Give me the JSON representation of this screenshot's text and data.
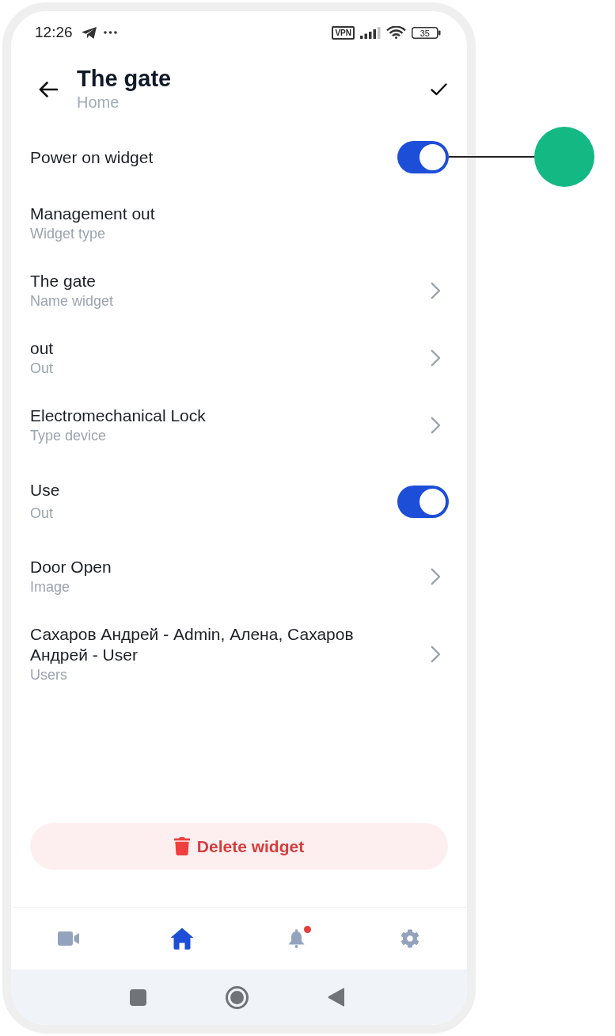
{
  "status_bar": {
    "time": "12:26",
    "vpn": "VPN",
    "battery": "35"
  },
  "header": {
    "title": "The gate",
    "subtitle": "Home"
  },
  "rows": [
    {
      "kind": "toggle",
      "label": "Power on widget",
      "on": true
    },
    {
      "kind": "info",
      "label": "Management out",
      "sublabel": "Widget type"
    },
    {
      "kind": "link",
      "label": "The gate",
      "sublabel": "Name widget"
    },
    {
      "kind": "link",
      "label": "out",
      "sublabel": "Out"
    },
    {
      "kind": "link",
      "label": "Electromechanical Lock",
      "sublabel": "Type device"
    },
    {
      "kind": "toggle",
      "label": "Use",
      "sublabel": "Out",
      "on": true
    },
    {
      "kind": "link",
      "label": "Door Open",
      "sublabel": "Image"
    },
    {
      "kind": "link",
      "label": "Сахаров Андрей - Admin, Алена, Сахаров Андрей - User",
      "sublabel": "Users"
    }
  ],
  "delete_button": {
    "label": "Delete widget"
  },
  "bottom_nav": [
    {
      "kind": "video",
      "selected": false,
      "notification": false
    },
    {
      "kind": "home",
      "selected": true,
      "notification": false
    },
    {
      "kind": "bell",
      "selected": false,
      "notification": true
    },
    {
      "kind": "gear",
      "selected": false,
      "notification": false
    }
  ]
}
